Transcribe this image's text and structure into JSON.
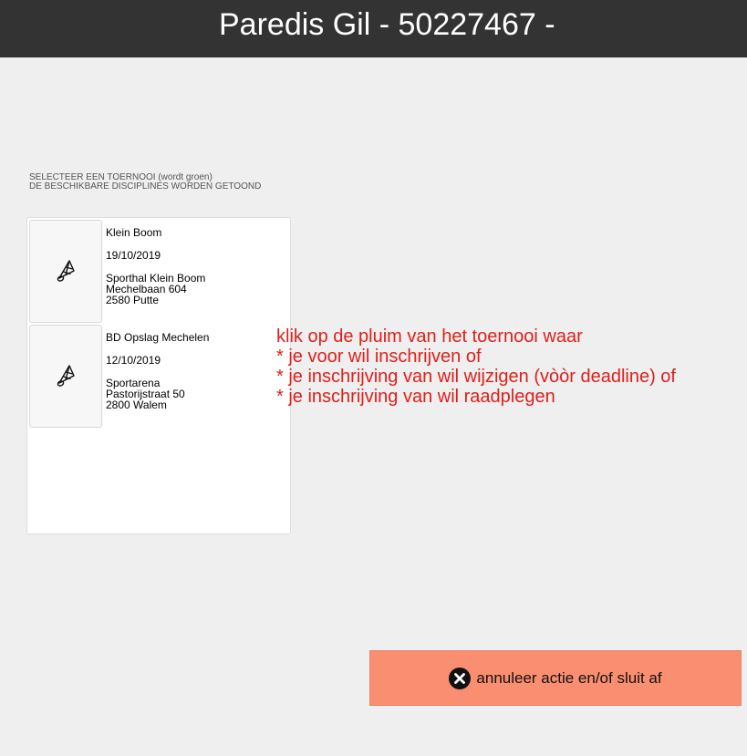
{
  "header": {
    "title": "Paredis Gil - 50227467 -"
  },
  "instructions": {
    "line1": "SELECTEER EEN TOERNOOI (wordt groen)",
    "line2": "DE BESCHIKBARE DISCIPLINES WORDEN GETOOND"
  },
  "tournaments": [
    {
      "icon": "shuttlecock-icon",
      "name": "Klein Boom",
      "date": "19/10/2019",
      "venue": [
        "Sporthal Klein Boom",
        "Mechelbaan 604",
        "2580 Putte"
      ]
    },
    {
      "icon": "shuttlecock-icon",
      "name": "BD Opslag Mechelen",
      "date": "12/10/2019",
      "venue": [
        "Sportarena",
        "Pastorijstraat 50",
        "2800 Walem"
      ]
    }
  ],
  "note": {
    "lines": [
      "klik op de pluim van het toernooi waar",
      "* je voor wil inschrijven of",
      "* je inschrijving van wil wijzigen (vòòr deadline) of",
      "* je inschrijving van wil raadplegen"
    ],
    "color": "#e0201b"
  },
  "cancel_button": {
    "label": "annuleer actie en/of sluit af",
    "icon": "close-circle-icon",
    "color": "#fa8e70"
  }
}
